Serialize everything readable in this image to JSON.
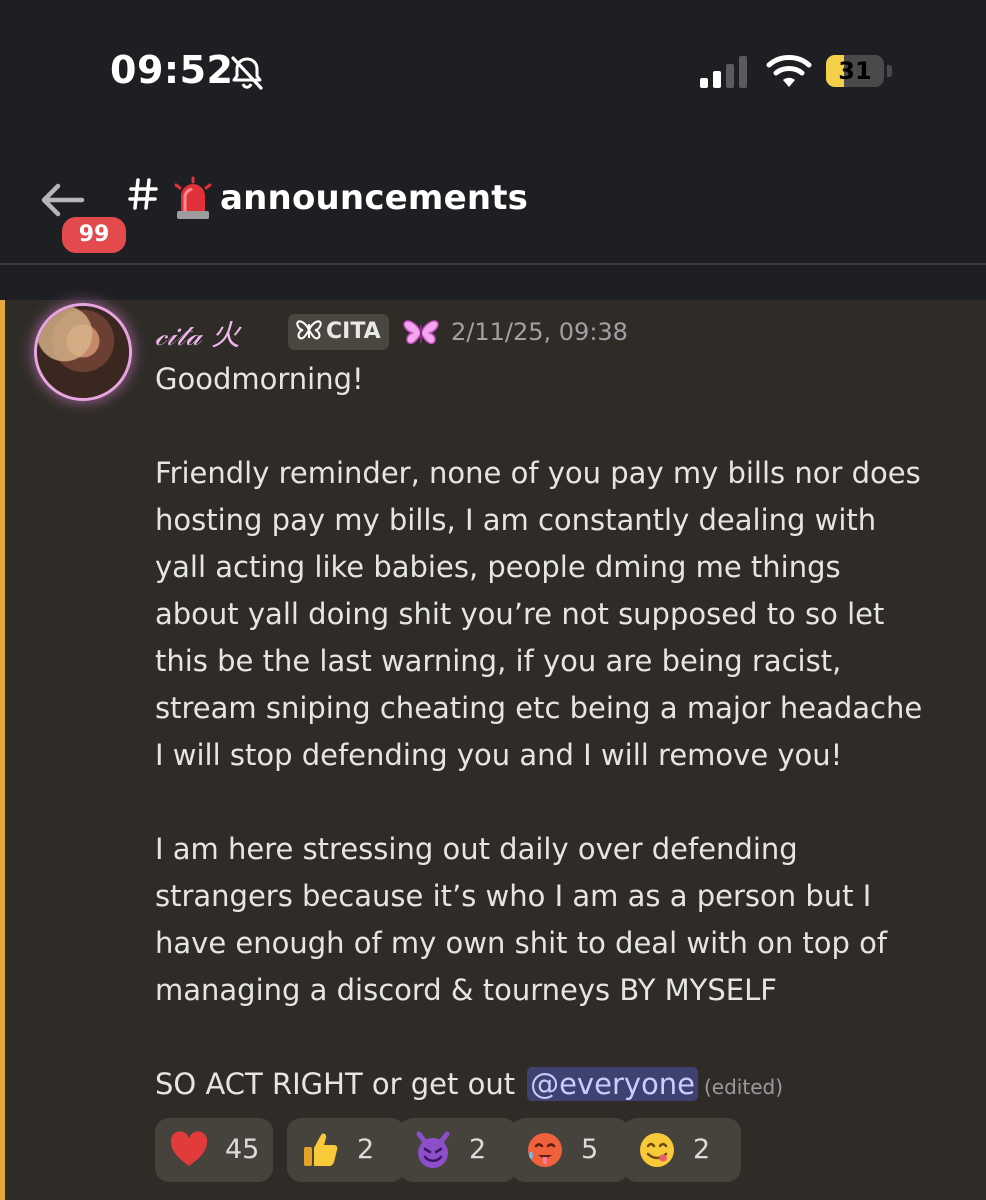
{
  "status_bar": {
    "time": "09:52",
    "battery_level": "31",
    "battery_fraction": 0.31,
    "icons": [
      "bell-slash-icon",
      "cellular-signal-icon",
      "wifi-icon",
      "battery-icon"
    ]
  },
  "header": {
    "back_badge_count": "99",
    "channel_name": "announcements",
    "channel_emoji": "siren-emoji",
    "colors": {
      "badge": "#e24a4d",
      "background": "#1e1f22"
    }
  },
  "message": {
    "author": "𝒸𝒾𝓉𝒶 火",
    "role_tag": "CITA",
    "role_icon": "butterfly-icon",
    "author_decoration": "pink-butterfly-icon",
    "timestamp": "2/11/25, 09:38",
    "greeting": "Goodmorning!",
    "paragraph1_lines": [
      "Friendly reminder, none of you pay my bills nor does",
      "hosting pay my bills, I am constantly dealing with",
      "yall acting like babies, people dming me things",
      "about yall doing shit you’re not supposed to so let",
      "this be the last warning, if you are being racist,",
      "stream sniping cheating etc being a major headache",
      "I will stop defending you and I will remove you!"
    ],
    "paragraph2_lines": [
      "I am here stressing out daily over defending",
      "strangers because it’s who I am as a person but I",
      "have enough of my own shit to deal with on top of",
      "managing a discord & tourneys BY MYSELF"
    ],
    "closing_text": "SO ACT RIGHT or get out",
    "mention": "@everyone",
    "edited_label": "(edited)",
    "colors": {
      "highlight_bar": "#e4a93a",
      "background": "#2f2c27",
      "author": "#f0b6ec",
      "mention_bg": "#3d4270"
    }
  },
  "reactions": [
    {
      "emoji": "red-heart-emoji",
      "count": "45"
    },
    {
      "emoji": "thumbs-up-emoji",
      "count": "2"
    },
    {
      "emoji": "smiling-imp-emoji",
      "count": "2"
    },
    {
      "emoji": "hot-face-emoji",
      "count": "5"
    },
    {
      "emoji": "face-savoring-food-emoji",
      "count": "2"
    }
  ]
}
